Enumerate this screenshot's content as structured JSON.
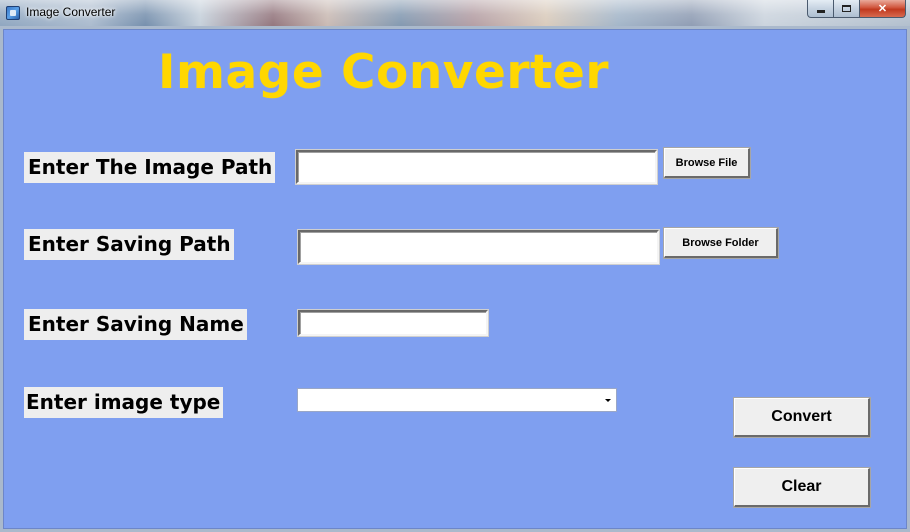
{
  "window": {
    "title": "Image Converter"
  },
  "app": {
    "heading": "Image Converter",
    "heading_color": "#FFD700",
    "background_color": "#7F9FF0"
  },
  "form": {
    "image_path": {
      "label": "Enter The Image Path",
      "value": "",
      "browse_label": "Browse File"
    },
    "saving_path": {
      "label": "Enter Saving Path",
      "value": "",
      "browse_label": "Browse Folder"
    },
    "saving_name": {
      "label": "Enter Saving Name",
      "value": ""
    },
    "image_type": {
      "label": "Enter image type",
      "selected": ""
    }
  },
  "actions": {
    "convert_label": "Convert",
    "clear_label": "Clear"
  },
  "icons": {
    "app": "app-icon",
    "minimize": "minimize-icon",
    "maximize": "maximize-icon",
    "close": "close-icon",
    "dropdown": "chevron-down-icon"
  }
}
